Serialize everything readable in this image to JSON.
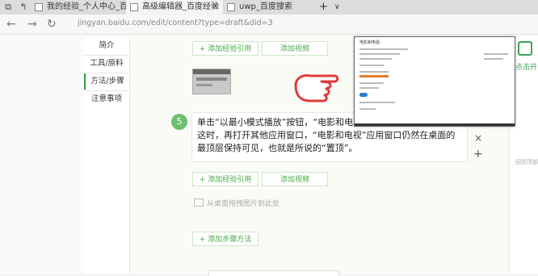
{
  "browser": {
    "tabs": [
      {
        "label": "我的经验_个人中心_百度经验"
      },
      {
        "label": "高级编辑器_百度经验"
      },
      {
        "label": "uwp_百度搜索"
      }
    ],
    "new_tab_symbol": "+",
    "tab_list_symbol": "∨",
    "address": "jingyan.baidu.com/edit/content?type=draft&did=3"
  },
  "leftnav": {
    "items": [
      {
        "label": "简介"
      },
      {
        "label": "工具/原料"
      },
      {
        "label": "方法/步骤"
      },
      {
        "label": "注意事项"
      }
    ]
  },
  "editor": {
    "add_reference_label": "+ 添加经验引用",
    "add_video_label": "添加视频",
    "step_number": "5",
    "step_text": "单击“以最小模式播放”按钮，“电影和电视”应用会缩小窗口\n这时，再打开其他应用窗口，“电影和电视”应用窗口仍然在桌面的最顶层保持可见，也就是所说的“置顶”。",
    "delete_symbol": "×",
    "add_symbol": "+",
    "add_reference_label2": "+ 添加经验引用",
    "add_video_label2": "添加视频",
    "upload_hint": "从桌面拖拽图片到此处",
    "add_step_label": "+ 添加步骤方法"
  },
  "overlay": {
    "title": "电影和电视",
    "accent_orange": "#e07b2c",
    "accent_blue": "#2a7ad5"
  },
  "rightcol": {
    "click_label": "点击开",
    "small_label": "回到顶部"
  },
  "colors": {
    "green": "#4aa84a",
    "step_circle": "#6cc06c",
    "pointer_red": "#e03a3a"
  }
}
